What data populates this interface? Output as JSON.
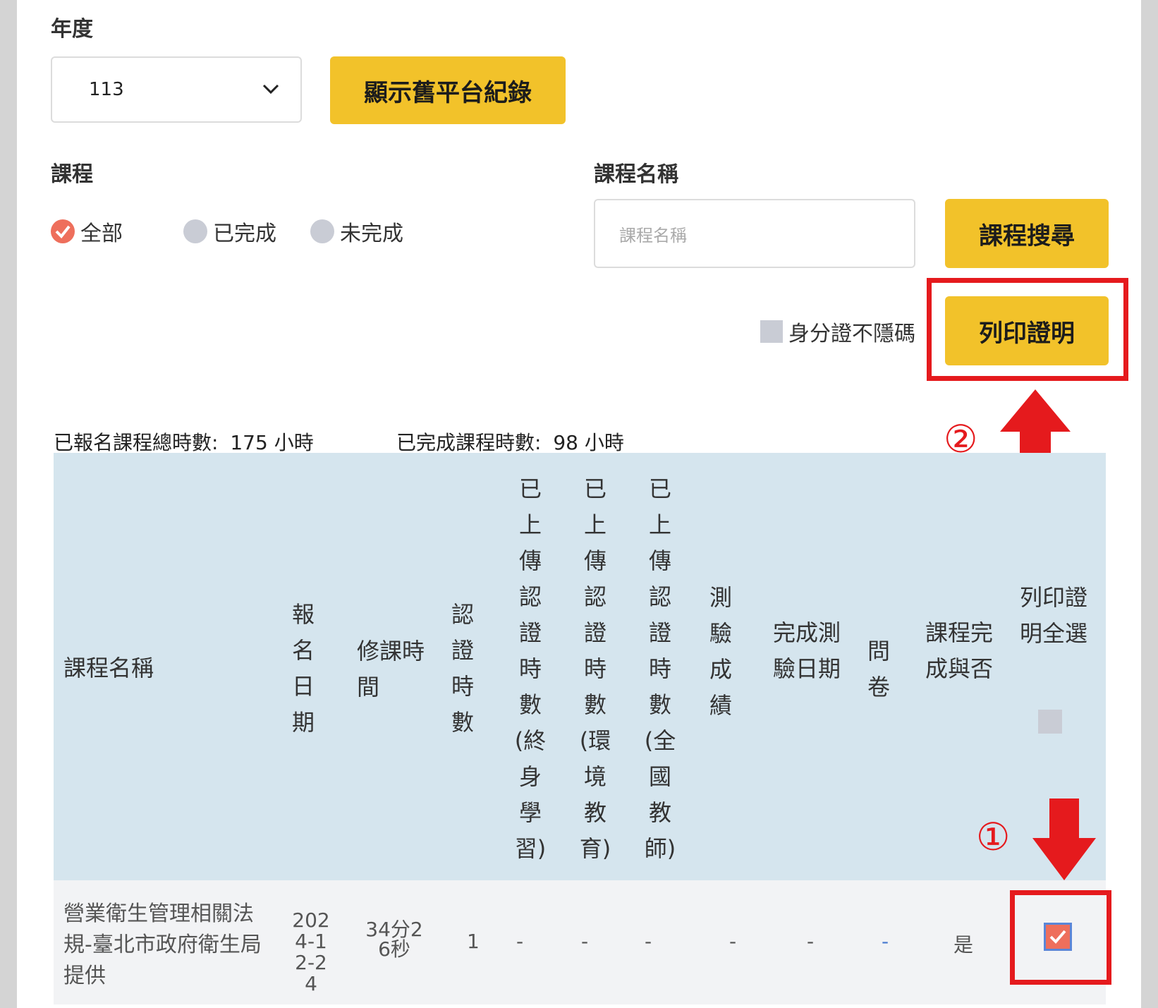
{
  "filters": {
    "year_label": "年度",
    "year_value": "113",
    "show_old_button": "顯示舊平台紀錄",
    "course_label": "課程",
    "radios": [
      {
        "label": "全部",
        "checked": true
      },
      {
        "label": "已完成",
        "checked": false
      },
      {
        "label": "未完成",
        "checked": false
      }
    ],
    "course_name_label": "課程名稱",
    "course_name_placeholder": "課程名稱",
    "search_button": "課程搜尋",
    "id_unmask_label": "身分證不隱碼",
    "print_button": "列印證明"
  },
  "summary": {
    "registered_label": "已報名課程總時數:",
    "registered_value": "175 小時",
    "completed_label": "已完成課程時數:",
    "completed_value": "98 小時"
  },
  "table": {
    "headers": {
      "course_name": "課程名稱",
      "reg_date": "報名日期",
      "study_time": "修課時間",
      "cert_hours": "認證時數",
      "uploaded_lifelong": "已上傳認證時數(終身學習)",
      "uploaded_env": "已上傳認證時數(環境教育)",
      "uploaded_teacher": "已上傳認證時數(全國教師)",
      "test_score": "測驗成績",
      "test_date": "完成測驗日期",
      "survey": "問卷",
      "completed": "課程完成與否",
      "print_all": "列印證明全選"
    },
    "row": {
      "course_name": "營業衛生管理相關法規-臺北市政府衛生局提供",
      "reg_date": "2024-12-24",
      "study_time": "34分26秒",
      "cert_hours": "1",
      "uploaded_lifelong": "-",
      "uploaded_env": "-",
      "uploaded_teacher": "-",
      "test_score": "-",
      "test_date": "-",
      "survey": "-",
      "completed": "是",
      "print_checked": true
    }
  },
  "annotations": {
    "step1": "①",
    "step2": "②",
    "color": "#e51a1d"
  },
  "colors": {
    "accent_yellow": "#f2c22a",
    "header_bg": "#d5e5ee",
    "radio_checked": "#ee6f5c"
  }
}
